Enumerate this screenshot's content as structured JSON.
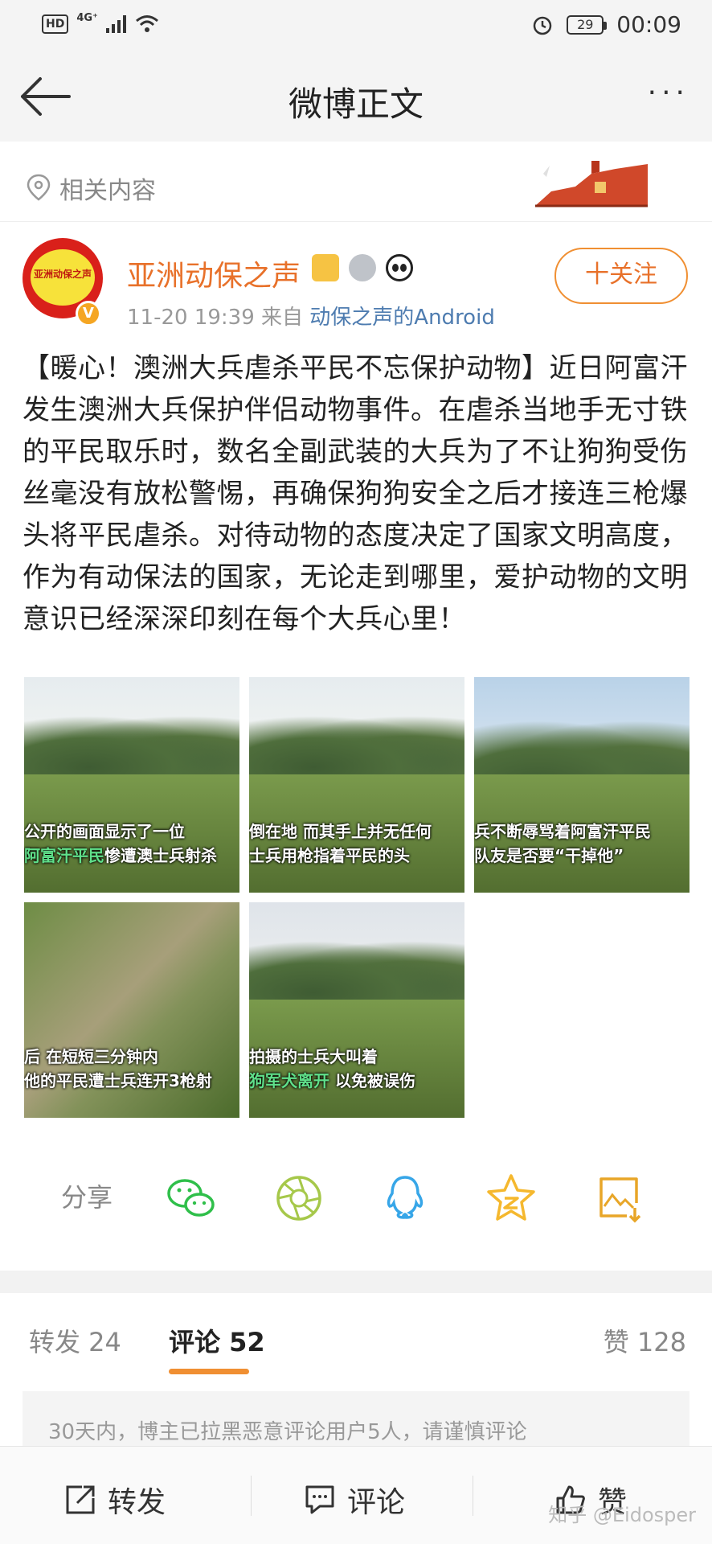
{
  "status_bar": {
    "hd": "HD",
    "network": "4G⁺",
    "battery": "29",
    "time": "00:09"
  },
  "nav": {
    "title": "微博正文",
    "more": "···"
  },
  "related": {
    "label": "相关内容"
  },
  "post": {
    "username": "亚洲动保之声",
    "avatar_text": "亚洲动保之声",
    "verified_badge": "V",
    "time": "11-20 19:39",
    "from_label": "来自",
    "source": "动保之声的Android",
    "follow_label": "十关注",
    "text": "【暖心！澳洲大兵虐杀平民不忘保护动物】近日阿富汗发生澳洲大兵保护伴侣动物事件。在虐杀当地手无寸铁的平民取乐时，数名全副武装的大兵为了不让狗狗受伤丝毫没有放松警惕，再确保狗狗安全之后才接连三枪爆头将平民虐杀。对待动物的态度决定了国家文明高度，作为有动保法的国家，无论走到哪里，爱护动物的文明意识已经深深印刻在每个大兵心里！",
    "images": [
      {
        "line1": "公开的画面显示了一位",
        "line2_green": "阿富汗平民",
        "line2": "惨遭澳士兵射杀"
      },
      {
        "line1": "倒在地 而其手上并无任何",
        "line2_green": "",
        "line2": "士兵用枪指着平民的头"
      },
      {
        "line1": "兵不断辱骂着阿富汗平民",
        "line2_green": "",
        "line2": "队友是否要“干掉他”"
      },
      {
        "line1": "后 在短短三分钟内",
        "line2_green": "",
        "line2": "他的平民遭士兵连开3枪射"
      },
      {
        "line1": "拍摄的士兵大叫着",
        "line2_green": "狗军犬离开",
        "line2": " 以免被误伤"
      }
    ]
  },
  "share": {
    "label": "分享",
    "icons": [
      "wechat-icon",
      "moments-icon",
      "qq-icon",
      "qzone-icon",
      "save-image-icon"
    ]
  },
  "tabs": {
    "repost": "转发 24",
    "comments": "评论 52",
    "likes": "赞 128"
  },
  "notice": "30天内，博主已拉黑恶意评论用户5人，请谨慎评论",
  "bottom_bar": {
    "repost": "转发",
    "comment": "评论",
    "like": "赞"
  },
  "watermark": "知乎 @Eidosper",
  "colors": {
    "accent": "#f08f32",
    "username": "#e8712a",
    "link": "#4e7cb0"
  }
}
